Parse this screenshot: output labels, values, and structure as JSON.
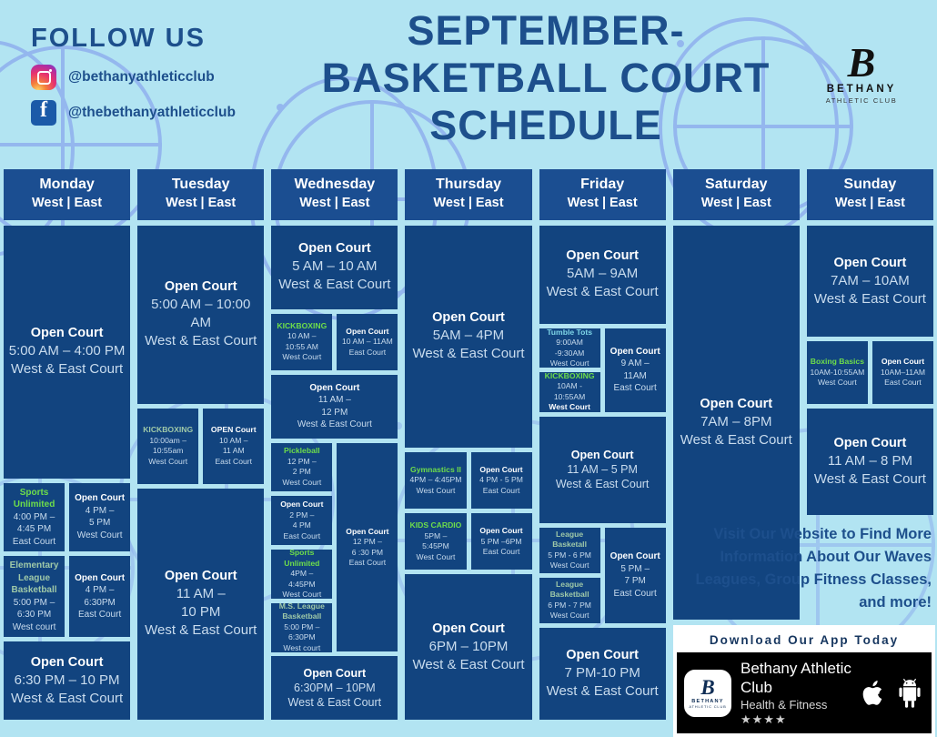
{
  "brand": {
    "logo_mark": "B",
    "logo_name": "BETHANY",
    "logo_sub": "ATHLETIC CLUB"
  },
  "follow": {
    "heading": "FOLLOW US",
    "instagram": "@bethanyathleticclub",
    "facebook": "@thebethanyathleticclub"
  },
  "title": "SEPTEMBER- BASKETBALL COURT SCHEDULE",
  "promo": {
    "text": "Visit Our Website to Find More Information About Our Waves Leagues, Group Fitness Classes, and more!",
    "download_heading": "Download Our App Today",
    "app_name": "Bethany Athletic Club",
    "app_category": "Health & Fitness",
    "app_rating": "★★★★",
    "app_icon_mark": "B",
    "app_icon_name": "BETHANY",
    "app_icon_sub": "ATHLETIC CLUB"
  },
  "courts_label": "West  |  East",
  "days": [
    {
      "name": "Monday",
      "courts": "West  |  East",
      "blocks": [
        {
          "name": "Open Court",
          "lines": [
            "5:00 AM – 4:00 PM",
            "West & East Court"
          ]
        }
      ],
      "pairs": [
        {
          "left": {
            "name": "Sports Unlimited",
            "color": "green",
            "lines": [
              "4:00 PM –",
              "4:45 PM",
              "East Court"
            ]
          },
          "right": {
            "name": "Open Court",
            "lines": [
              "4 PM –",
              "5 PM",
              "West Court"
            ]
          }
        },
        {
          "left": {
            "name": "Elementary League Basketball",
            "color": "pale",
            "lines": [
              "5:00 PM –",
              "6:30 PM",
              "West court"
            ]
          },
          "right": {
            "name": "Open Court",
            "lines": [
              "4 PM –",
              "6:30PM",
              "East Court"
            ]
          }
        }
      ],
      "footer": {
        "name": "Open Court",
        "lines": [
          "6:30 PM – 10 PM",
          "West & East Court"
        ]
      }
    },
    {
      "name": "Tuesday",
      "courts": "West  |  East",
      "blocks": [
        {
          "name": "Open Court",
          "lines": [
            "5:00 AM – 10:00 AM",
            "West & East Court"
          ]
        }
      ],
      "pairs": [
        {
          "left": {
            "name": "KICKBOXING",
            "color": "pale",
            "lines": [
              "10:00am –",
              "10:55am",
              "West Court"
            ]
          },
          "right": {
            "name": "OPEN Court",
            "lines": [
              "10 AM –",
              "11 AM",
              "East Court"
            ]
          }
        }
      ],
      "footer": {
        "name": "Open Court",
        "lines": [
          "11 AM –",
          "10 PM",
          "West & East Court"
        ]
      }
    },
    {
      "name": "Wednesday",
      "courts": "West  |  East",
      "blocks": [
        {
          "name": "Open Court",
          "lines": [
            "5 AM – 10 AM",
            "West & East Court"
          ]
        }
      ],
      "pairs": [
        {
          "left": {
            "name": "KICKBOXING",
            "color": "green",
            "lines": [
              "10  AM –",
              "10:55 AM",
              "West Court"
            ]
          },
          "right": {
            "name": "Open Court",
            "lines": [
              "10 AM – 11AM",
              "East Court"
            ]
          }
        }
      ],
      "mid": {
        "name": "Open Court",
        "lines": [
          "11 AM –",
          "12 PM",
          "West & East Court"
        ]
      },
      "split": {
        "left": [
          {
            "name": "Pickleball",
            "color": "green",
            "lines": [
              "12 PM –",
              "2 PM",
              "West Court"
            ]
          },
          {
            "name": "Open Court",
            "lines": [
              "2 PM –",
              "4 PM",
              "East Court"
            ]
          },
          {
            "name": "Sports Unlimited",
            "color": "green",
            "lines": [
              "4PM –",
              "4:45PM",
              "West Court"
            ]
          },
          {
            "name": "M.S. League Basketball",
            "color": "pale",
            "lines": [
              "5:00 PM –",
              "6:30PM",
              "West court"
            ]
          }
        ],
        "right": [
          {
            "name": "Open Court",
            "lines": [
              "12 PM –",
              "6 :30 PM",
              "East Court"
            ]
          }
        ]
      },
      "footer": {
        "name": "Open Court",
        "lines": [
          "6:30PM – 10PM",
          "West & East Court"
        ]
      }
    },
    {
      "name": "Thursday",
      "courts": "West  |  East",
      "blocks": [
        {
          "name": "Open Court",
          "lines": [
            "5AM – 4PM",
            "West & East Court"
          ]
        }
      ],
      "pairs": [
        {
          "left": {
            "name": "Gymnastics II",
            "color": "green",
            "lines": [
              "4PM – 4:45PM",
              "West Court"
            ]
          },
          "right": {
            "name": "Open Court",
            "lines": [
              "4 PM - 5 PM",
              "East Court"
            ]
          }
        },
        {
          "left": {
            "name": "KIDS CARDIO",
            "color": "green",
            "lines": [
              "5PM –",
              "5:45PM",
              "West Court"
            ]
          },
          "right": {
            "name": "Open Court",
            "lines": [
              "5 PM –6PM",
              "East Court"
            ]
          }
        }
      ],
      "footer": {
        "name": "Open Court",
        "lines": [
          "6PM – 10PM",
          "West & East Court"
        ]
      }
    },
    {
      "name": "Friday",
      "courts": "West  |  East",
      "blocks": [
        {
          "name": "Open Court",
          "lines": [
            "5AM – 9AM",
            "West & East Court"
          ]
        }
      ],
      "split_top": {
        "left": [
          {
            "name": "Tumble Tots",
            "color": "teal",
            "lines": [
              "9:00AM -9:30AM",
              "West Court"
            ]
          },
          {
            "name": "KICKBOXING",
            "color": "green",
            "lines": [
              "10AM - 10:55AM",
              "West Court"
            ],
            "bold_last": true
          }
        ],
        "right": [
          {
            "name": "Open Court",
            "lines": [
              "9 AM –",
              "11AM",
              "East Court"
            ]
          }
        ]
      },
      "mid": {
        "name": "Open Court",
        "lines": [
          "11 AM – 5 PM",
          "West & East Court"
        ]
      },
      "split_bottom": {
        "left": [
          {
            "name": "League Basketall",
            "color": "pale",
            "lines": [
              "5 PM - 6 PM",
              "West Court"
            ]
          },
          {
            "name": "League Basketball",
            "color": "pale",
            "lines": [
              "6 PM -  7  PM",
              "West Court"
            ]
          }
        ],
        "right": [
          {
            "name": "Open Court",
            "lines": [
              "5 PM –",
              "7 PM",
              "East Court"
            ]
          }
        ]
      },
      "footer": {
        "name": "Open Court",
        "lines": [
          "7 PM-10 PM",
          "West & East Court"
        ]
      }
    },
    {
      "name": "Saturday",
      "courts": "West  |  East",
      "blocks": [
        {
          "name": "Open Court",
          "lines": [
            "7AM – 8PM",
            "West & East Court"
          ],
          "plain": true
        }
      ]
    },
    {
      "name": "Sunday",
      "courts": "West  |  East",
      "blocks": [
        {
          "name": "Open Court",
          "lines": [
            "7AM – 10AM",
            "West & East Court"
          ]
        }
      ],
      "pairs": [
        {
          "left": {
            "name": "Boxing Basics",
            "color": "green",
            "lines": [
              "10AM-10:55AM",
              "West Court"
            ]
          },
          "right": {
            "name": "Open Court",
            "lines": [
              "10AM–11AM",
              "East Court"
            ]
          }
        }
      ],
      "footer": {
        "name": "Open Court",
        "lines": [
          "11 AM – 8 PM",
          "West & East Court"
        ]
      }
    }
  ],
  "colors": {
    "background": "#b2e4f2",
    "header_blue": "#1b4e91",
    "block_blue": "#12447f",
    "title_blue": "#1d4f8c",
    "accent_green": "#6ede4a",
    "accent_teal": "#7fd6e8",
    "ball_outline": "#8fb0ee"
  }
}
